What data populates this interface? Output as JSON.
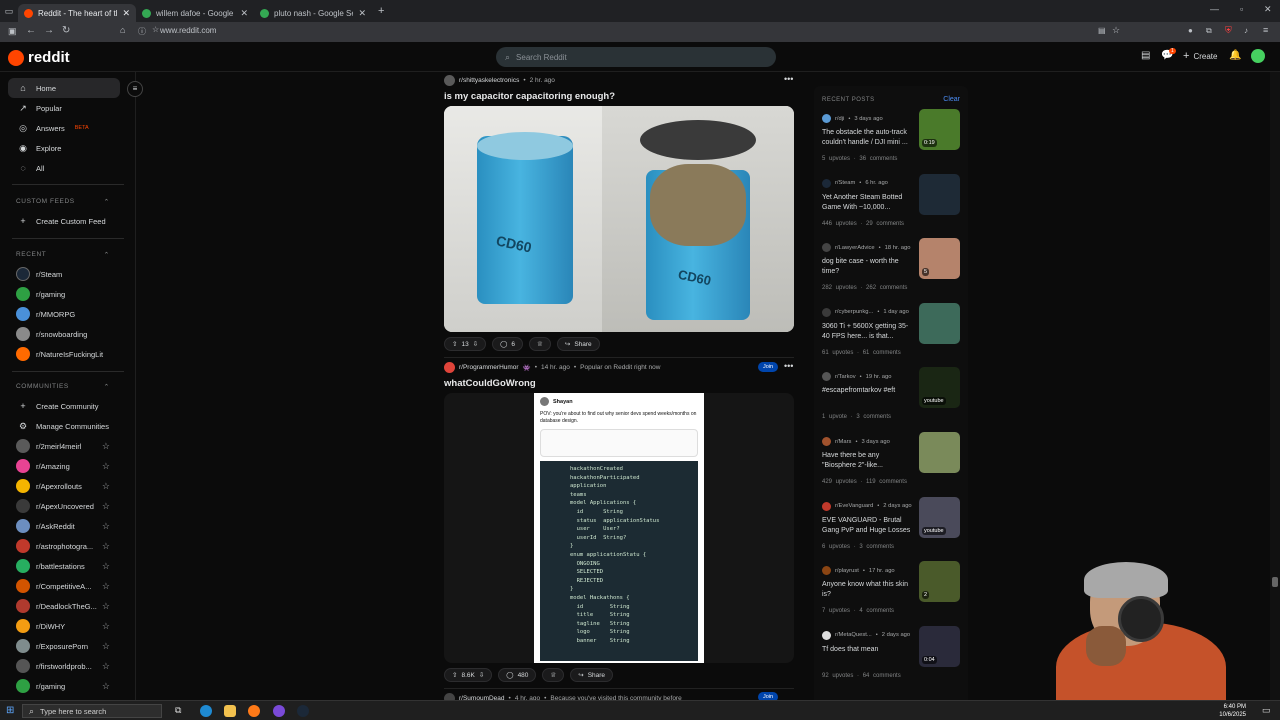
{
  "browser": {
    "tabs": [
      {
        "title": "Reddit - The heart of the intern",
        "active": true,
        "color": "#ff4500"
      },
      {
        "title": "willem dafoe - Google Search",
        "active": false,
        "color": "#34a853"
      },
      {
        "title": "pluto nash - Google Search",
        "active": false,
        "color": "#34a853"
      }
    ],
    "url": "www.reddit.com"
  },
  "header": {
    "logo_text": "reddit",
    "search_placeholder": "Search Reddit",
    "create_label": "Create",
    "notification_count": "1"
  },
  "sidebar": {
    "nav": [
      {
        "label": "Home",
        "icon": "home-icon",
        "glyph": "⌂",
        "active": true
      },
      {
        "label": "Popular",
        "icon": "popular-icon",
        "glyph": "↗",
        "active": false
      },
      {
        "label": "Answers",
        "icon": "answers-icon",
        "glyph": "◎",
        "active": false,
        "badge": "BETA"
      },
      {
        "label": "Explore",
        "icon": "explore-icon",
        "glyph": "◉",
        "active": false
      },
      {
        "label": "All",
        "icon": "all-icon",
        "glyph": "◌",
        "active": false
      }
    ],
    "custom_feeds_heading": "CUSTOM FEEDS",
    "create_custom_feed": "Create Custom Feed",
    "recent_heading": "RECENT",
    "recent": [
      {
        "name": "r/Steam",
        "color": "#1b2838"
      },
      {
        "name": "r/gaming",
        "color": "#2ea043"
      },
      {
        "name": "r/MMORPG",
        "color": "#4a90d9"
      },
      {
        "name": "r/snowboarding",
        "color": "#8a8a8a"
      },
      {
        "name": "r/NatureIsFuckingLit",
        "color": "#ff6a00"
      }
    ],
    "communities_heading": "COMMUNITIES",
    "create_community": "Create Community",
    "manage_communities": "Manage Communities",
    "communities": [
      {
        "name": "r/2meirl4meirl",
        "color": "#5a5a5a"
      },
      {
        "name": "r/Amazing",
        "color": "#e84393"
      },
      {
        "name": "r/Apexrollouts",
        "color": "#f4b400"
      },
      {
        "name": "r/ApexUncovered",
        "color": "#3a3a3a"
      },
      {
        "name": "r/AskReddit",
        "color": "#6c8ebf"
      },
      {
        "name": "r/astrophotogra...",
        "color": "#c0392b"
      },
      {
        "name": "r/battlestations",
        "color": "#27ae60"
      },
      {
        "name": "r/CompetitiveA...",
        "color": "#d35400"
      },
      {
        "name": "r/DeadlockTheG...",
        "color": "#b03a2e"
      },
      {
        "name": "r/DiWHY",
        "color": "#f39c12"
      },
      {
        "name": "r/ExposurePorn",
        "color": "#7f8c8d"
      },
      {
        "name": "r/firstworldprob...",
        "color": "#555555"
      },
      {
        "name": "r/gaming",
        "color": "#2ea043"
      }
    ]
  },
  "feed": {
    "post1": {
      "subreddit": "r/shittyaskelectronics",
      "time": "2 hr. ago",
      "title": "is my capacitor capacitoring enough?",
      "upvotes": "13",
      "comments": "6",
      "share": "Share",
      "image_left_text": "CD60",
      "image_right_text": "CD60"
    },
    "post2": {
      "subreddit": "r/ProgrammerHumor",
      "time": "14 hr. ago",
      "popular_note": "Popular on Reddit right now",
      "title": "whatCouldGoWrong",
      "join": "Join",
      "upvotes": "8.6K",
      "comments": "480",
      "share": "Share",
      "tweet_author": "Shayan",
      "tweet_text": "POV: you're about to find out why senior devs spend weeks/months on database design.",
      "code_lines": [
        "hackathonCreated",
        "hackathonParticipated",
        "application",
        "teams",
        "model Applications {",
        "  id      String",
        "  status  applicationStatus",
        "  user    User?",
        "  userId  String?",
        "}",
        "enum applicationStatu {",
        "  ONGOING",
        "  SELECTED",
        "  REJECTED",
        "}",
        "model Hackathons {",
        "  id        String",
        "  title     String",
        "  tagline   String",
        "  logo      String",
        "  banner    String"
      ]
    },
    "post3": {
      "subreddit": "r/SumoumDead",
      "time": "4 hr. ago",
      "note": "Because you've visited this community before",
      "join": "Join"
    }
  },
  "recent_posts": {
    "heading": "RECENT POSTS",
    "clear": "Clear",
    "items": [
      {
        "sub": "r/dji",
        "time": "3 days ago",
        "title": "The obstacle the auto-track couldn't handle / DJI mini ...",
        "upvotes": "5 upvotes",
        "comments": "36 comments",
        "badge": "0:19",
        "thumb": "#4a7a2a",
        "avatar": "#5b9bd5"
      },
      {
        "sub": "r/Steam",
        "time": "6 hr. ago",
        "title": "Yet Another Steam Botted Game With ~10,000...",
        "upvotes": "446 upvotes",
        "comments": "29 comments",
        "badge": "",
        "thumb": "#1e2a36",
        "avatar": "#1b2838"
      },
      {
        "sub": "r/LawyerAdvice",
        "time": "18 hr. ago",
        "title": "dog bite case - worth the time?",
        "upvotes": "282 upvotes",
        "comments": "262 comments",
        "badge": "5",
        "thumb": "#b5836b",
        "avatar": "#444444"
      },
      {
        "sub": "r/cyberpunkg...",
        "time": "1 day ago",
        "title": "3060 Ti + 5600X getting 35-40 FPS here... is that...",
        "upvotes": "61 upvotes",
        "comments": "61 comments",
        "badge": "",
        "thumb": "#3d6a5a",
        "avatar": "#3a3a3a"
      },
      {
        "sub": "r/Tarkov",
        "time": "19 hr. ago",
        "title": "#escapefromtarkov #eft",
        "upvotes": "1 upvote",
        "comments": "3 comments",
        "badge": "youtube",
        "thumb": "#1a2614",
        "avatar": "#555555"
      },
      {
        "sub": "r/Mars",
        "time": "3 days ago",
        "title": "Have there be any \"Biosphere 2\"-like...",
        "upvotes": "429 upvotes",
        "comments": "119 comments",
        "badge": "",
        "thumb": "#7a8a5a",
        "avatar": "#a0522d"
      },
      {
        "sub": "r/EveVanguard",
        "time": "2 days ago",
        "title": "EVE VANGUARD - Brutal Gang PvP and Huge Losses",
        "upvotes": "6 upvotes",
        "comments": "3 comments",
        "badge": "youtube",
        "thumb": "#4a4a5a",
        "avatar": "#c0392b"
      },
      {
        "sub": "r/playrust",
        "time": "17 hr. ago",
        "title": "Anyone know what this skin is?",
        "upvotes": "7 upvotes",
        "comments": "4 comments",
        "badge": "2",
        "thumb": "#4a5a2a",
        "avatar": "#8b4513"
      },
      {
        "sub": "r/MetaQuest...",
        "time": "2 days ago",
        "title": "Tf does that mean",
        "upvotes": "92 upvotes",
        "comments": "64 comments",
        "badge": "0:04",
        "thumb": "#2a2a3a",
        "avatar": "#dddddd"
      }
    ]
  },
  "taskbar": {
    "search_placeholder": "Type here to search",
    "time": "6:40 PM",
    "date": "10/6/2025"
  }
}
